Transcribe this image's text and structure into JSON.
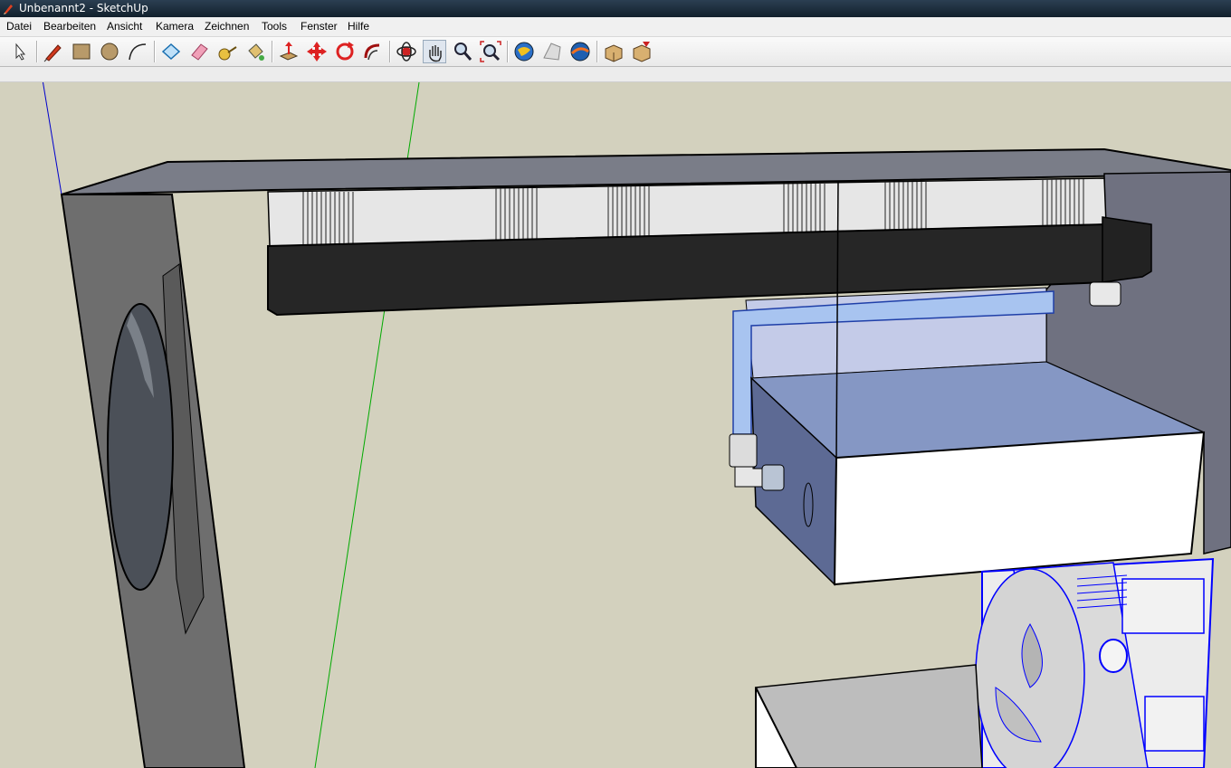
{
  "window": {
    "title": "Unbenannt2 - SketchUp",
    "icon": "sketchup-pencil-icon"
  },
  "menu": {
    "items": [
      {
        "label": "Datei"
      },
      {
        "label": "Bearbeiten"
      },
      {
        "label": "Ansicht"
      },
      {
        "label": "Kamera"
      },
      {
        "label": "Zeichnen"
      },
      {
        "label": "Tools"
      },
      {
        "label": "Fenster"
      },
      {
        "label": "Hilfe"
      }
    ]
  },
  "toolbar": {
    "tools": [
      "select-arrow-icon",
      "pencil-line-icon",
      "rectangle-icon",
      "circle-icon",
      "arc-icon",
      "make-component-icon",
      "eraser-icon",
      "tape-measure-icon",
      "paint-bucket-icon",
      "push-pull-icon",
      "move-icon",
      "rotate-icon",
      "follow-me-icon",
      "orbit-icon",
      "pan-hand-icon",
      "zoom-icon",
      "zoom-extents-icon",
      "get-models-icon",
      "share-model-icon",
      "google-earth-icon",
      "component-open-icon",
      "component-share-icon"
    ],
    "active_tool": "pan-hand-icon"
  },
  "colors": {
    "background": "#d3d1be",
    "axis_blue": "#0000cc",
    "axis_green": "#00aa00",
    "selection_blue": "#0000ff",
    "radiator_black": "#262626",
    "case_gray": "#6b6b6b",
    "reservoir_blue": "#a8b8dc"
  }
}
